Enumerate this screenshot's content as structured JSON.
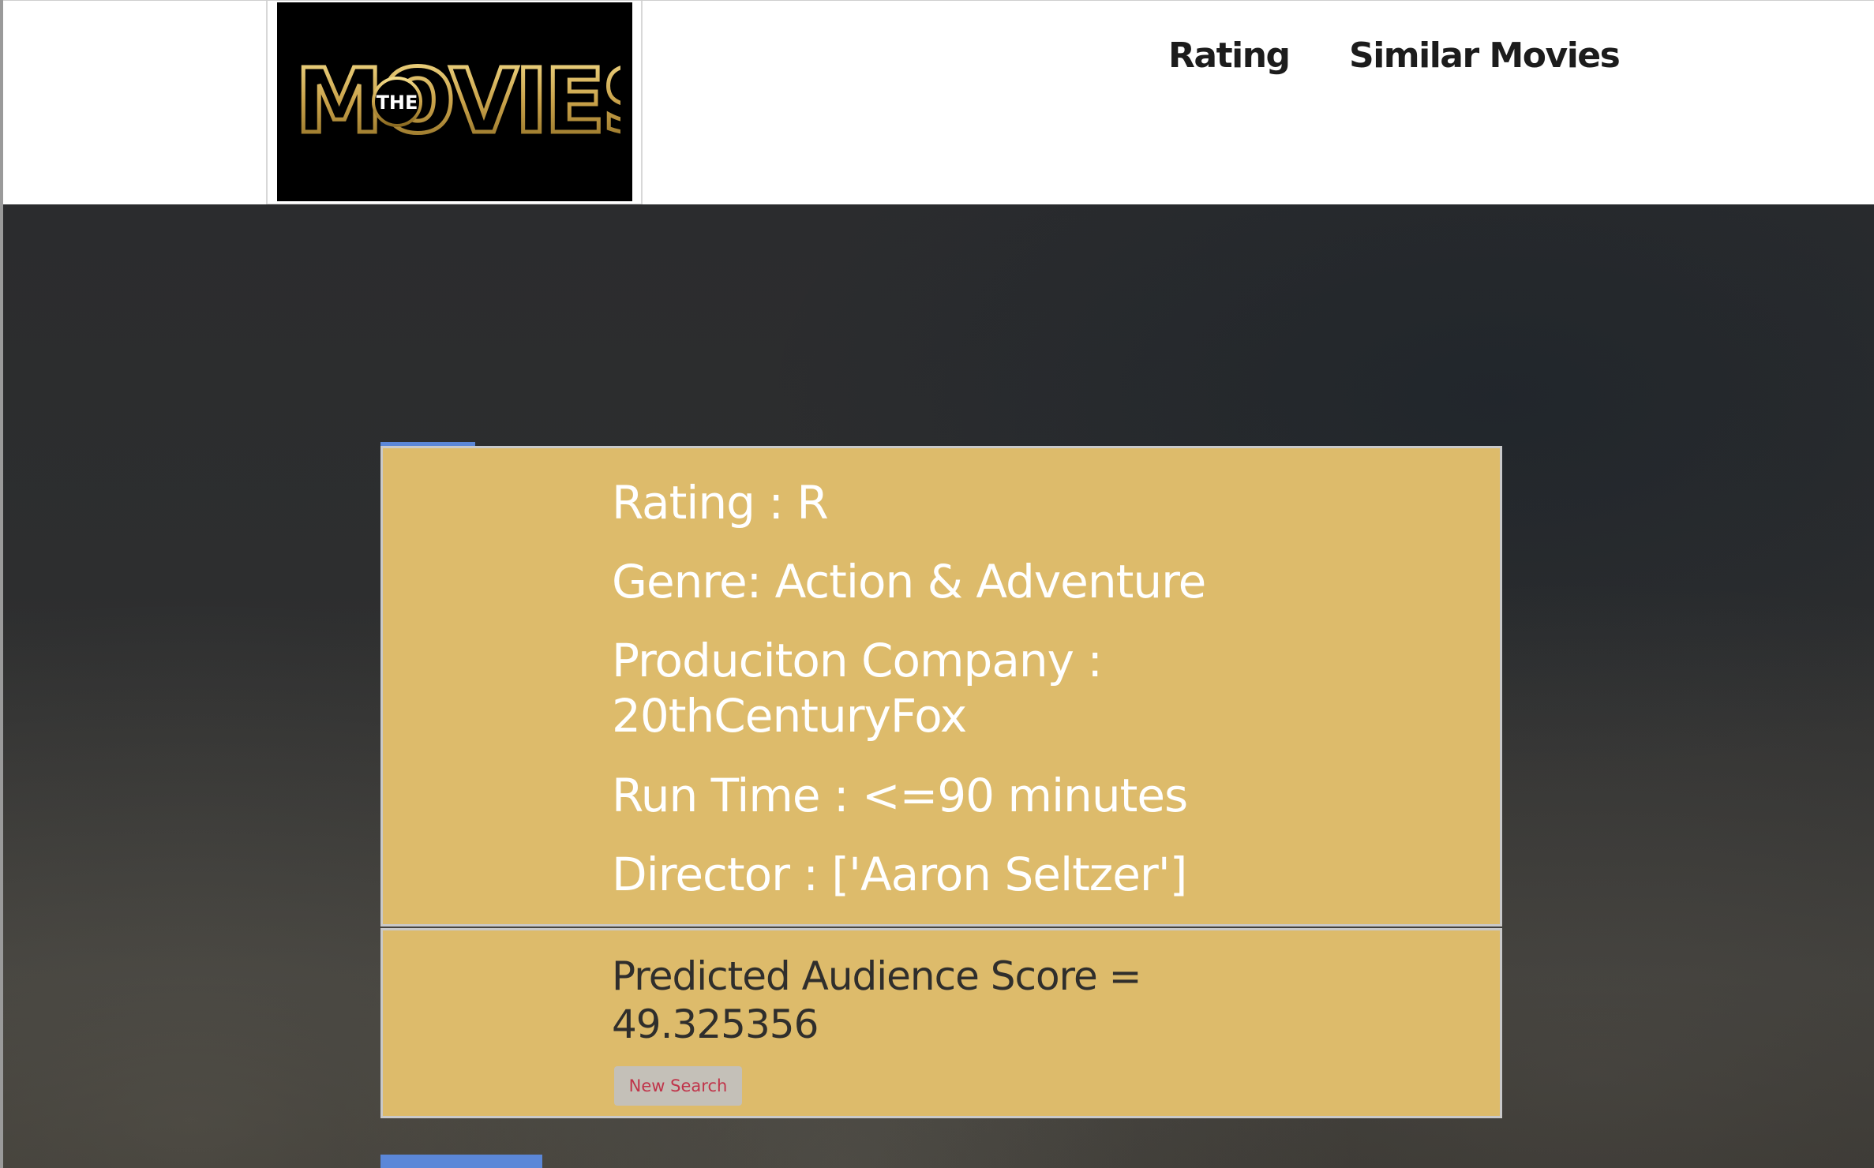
{
  "header": {
    "logo": {
      "text_small": "THE",
      "text_big": "MOVIES",
      "brand_color": "#c9a24a"
    },
    "nav": [
      {
        "label": "Rating"
      },
      {
        "label": "Similar Movies"
      }
    ]
  },
  "movie_info": {
    "rating": "Rating : R",
    "genre": "Genre: Action & Adventure",
    "company_line1": "Produciton Company :",
    "company_line2": "20thCenturyFox",
    "runtime": "Run Time : <=90 minutes",
    "director": "Director : ['Aaron Seltzer']"
  },
  "prediction": {
    "label_line1": "Predicted Audience Score =",
    "label_line2": "49.325356",
    "new_search_label": "New Search"
  },
  "colors": {
    "card_bg": "#ddbb6b",
    "accent_tab": "#5b87d8",
    "button_text": "#c0344a"
  }
}
